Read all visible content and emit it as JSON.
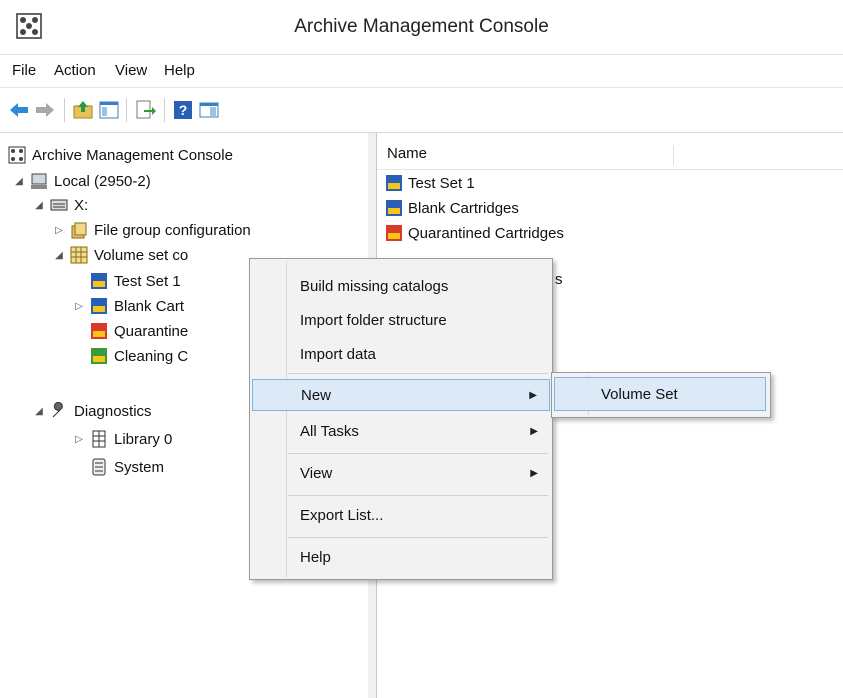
{
  "window": {
    "title": "Archive Management Console"
  },
  "menubar": {
    "items": [
      "File",
      "Action",
      "View",
      "Help"
    ]
  },
  "toolbar": {
    "icons": [
      "back-arrow-icon",
      "forward-arrow-icon",
      "up-folder-icon",
      "show-hide-tree-icon",
      "export-list-icon",
      "help-icon",
      "action-pane-icon"
    ]
  },
  "tree": {
    "items": [
      {
        "label": "Archive Management Console",
        "icon": "console-icon",
        "arrow": ""
      },
      {
        "label": "Local (2950-2)",
        "icon": "computer-icon",
        "arrow": "◢"
      },
      {
        "label": "X:",
        "icon": "drive-icon",
        "arrow": "◢"
      },
      {
        "label": "File group configuration",
        "icon": "file-group-icon",
        "arrow": "▷"
      },
      {
        "label": "Volume set co",
        "icon": "volume-set-icon",
        "arrow": "◢"
      },
      {
        "label": "Test Set 1",
        "icon": "cartridge-blue-icon",
        "arrow": ""
      },
      {
        "label": "Blank Cart",
        "icon": "cartridge-blue-icon",
        "arrow": "▷"
      },
      {
        "label": "Quarantine",
        "icon": "cartridge-red-icon",
        "arrow": ""
      },
      {
        "label": "Cleaning C",
        "icon": "cartridge-green-icon",
        "arrow": ""
      },
      {
        "label": "Diagnostics",
        "icon": "wrench-icon",
        "arrow": "◢"
      },
      {
        "label": "Library 0",
        "icon": "library-icon",
        "arrow": "▷"
      },
      {
        "label": "System",
        "icon": "system-icon",
        "arrow": ""
      }
    ]
  },
  "list": {
    "column_name": "Name",
    "rows": [
      {
        "label": "Test Set 1",
        "icon": "cartridge-blue-icon"
      },
      {
        "label": "Blank Cartridges",
        "icon": "cartridge-blue-icon"
      },
      {
        "label": "Quarantined Cartridges",
        "icon": "cartridge-red-icon"
      }
    ],
    "partial_text": "s"
  },
  "context_menu": {
    "items": [
      {
        "label": "Build missing catalogs",
        "submenu": false
      },
      {
        "label": "Import folder structure",
        "submenu": false
      },
      {
        "label": "Import data",
        "submenu": false
      },
      {
        "label": "New",
        "submenu": true,
        "highlighted": true
      },
      {
        "label": "All Tasks",
        "submenu": true
      },
      {
        "label": "View",
        "submenu": true
      },
      {
        "label": "Export List...",
        "submenu": false
      },
      {
        "label": "Help",
        "submenu": false
      }
    ]
  },
  "submenu": {
    "items": [
      {
        "label": "Volume Set",
        "highlighted": true
      }
    ]
  },
  "colors": {
    "highlight_bg": "#dceaf7",
    "highlight_border": "#7eb4ea",
    "menu_bg": "#f2f2f2"
  }
}
